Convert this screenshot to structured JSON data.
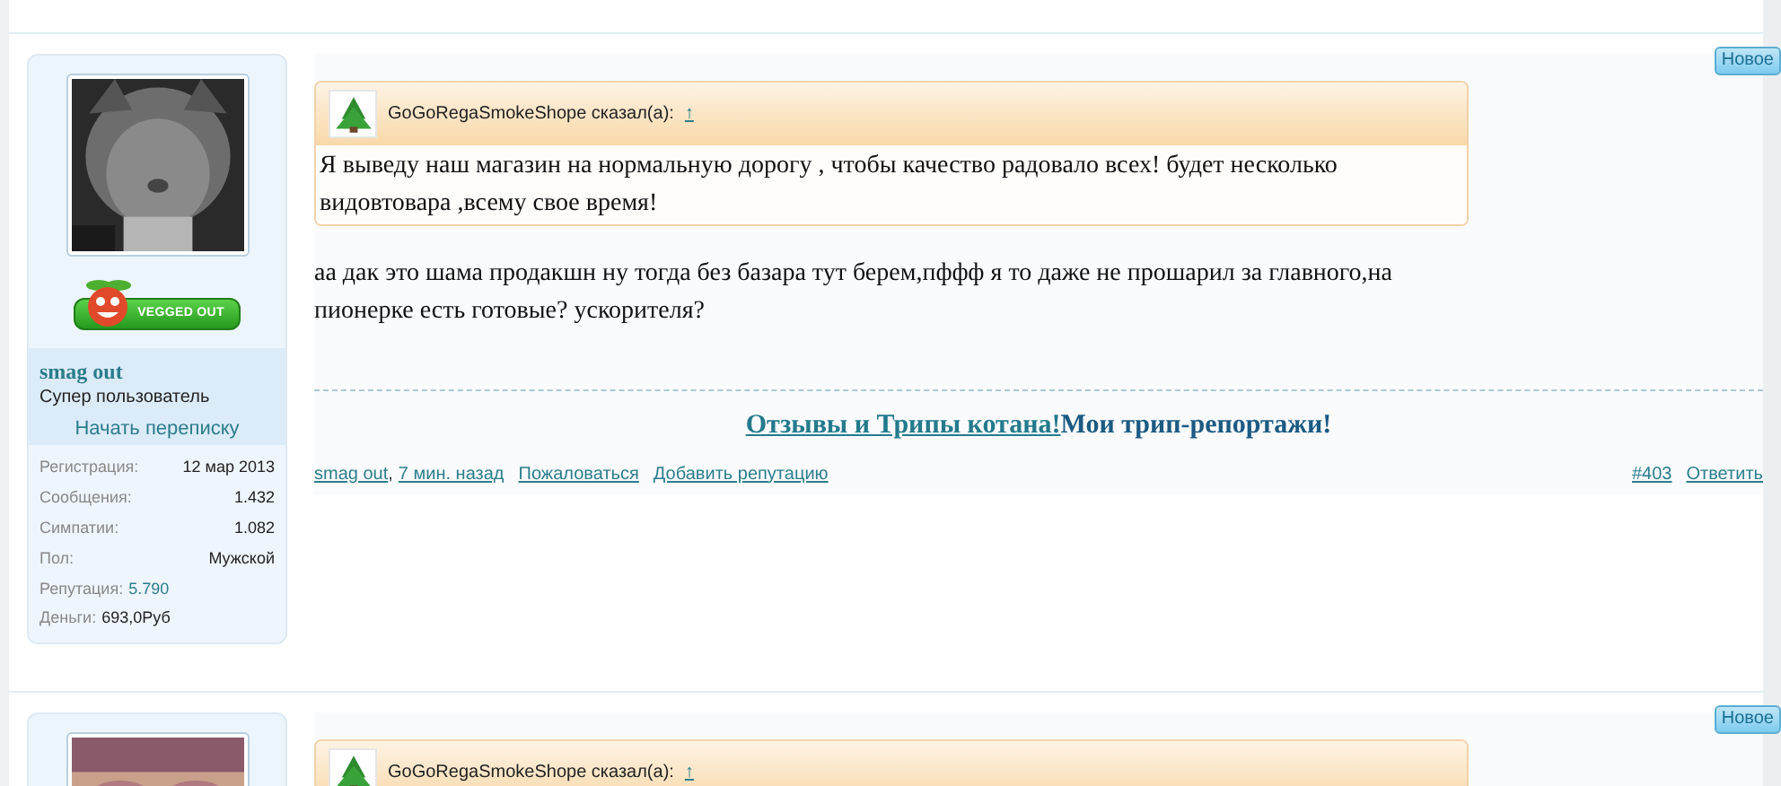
{
  "posts": [
    {
      "new_label": "Новое",
      "author": {
        "badge_text": "VEGGED OUT",
        "name": "smag out",
        "title": "Супер пользователь",
        "message_link": "Начать переписку",
        "stats": [
          {
            "kind": "split",
            "label": "Регистрация:",
            "value": "12 мар 2013"
          },
          {
            "kind": "split",
            "label": "Сообщения:",
            "value": "1.432"
          },
          {
            "kind": "split",
            "label": "Симпатии:",
            "value": "1.082"
          },
          {
            "kind": "split",
            "label": "Пол:",
            "value": "Мужской"
          },
          {
            "kind": "accent",
            "label": "Репутация:",
            "value": "5.790"
          },
          {
            "kind": "inline",
            "label": "Деньги:",
            "value": "693,0Руб"
          }
        ]
      },
      "quote": {
        "said": "GoGoRegaSmokeShope сказал(а):",
        "up": "↑",
        "text": "Я выведу наш магазин на нормальную дорогу , чтобы качество радовало всех! будет несколько видовтовара ,всему свое время!"
      },
      "body": "аа дак это шама продакшн ну тогда без базара тут берем,пффф я то даже не прошарил за главного,на пионерке есть готовые? ускорителя?",
      "signature": {
        "link": "Отзывы и Трипы котана!",
        "text": "Мои трип-репортажи!"
      },
      "footer": {
        "author": "smag out",
        "separator": ",",
        "time": "7 мин. назад",
        "actions": [
          "Пожаловаться",
          "Добавить репутацию"
        ],
        "number": "#403",
        "reply": "Ответить"
      }
    },
    {
      "new_label": "Новое",
      "quote": {
        "said": "GoGoRegaSmokeShope сказал(а):",
        "up": "↑"
      }
    }
  ]
}
